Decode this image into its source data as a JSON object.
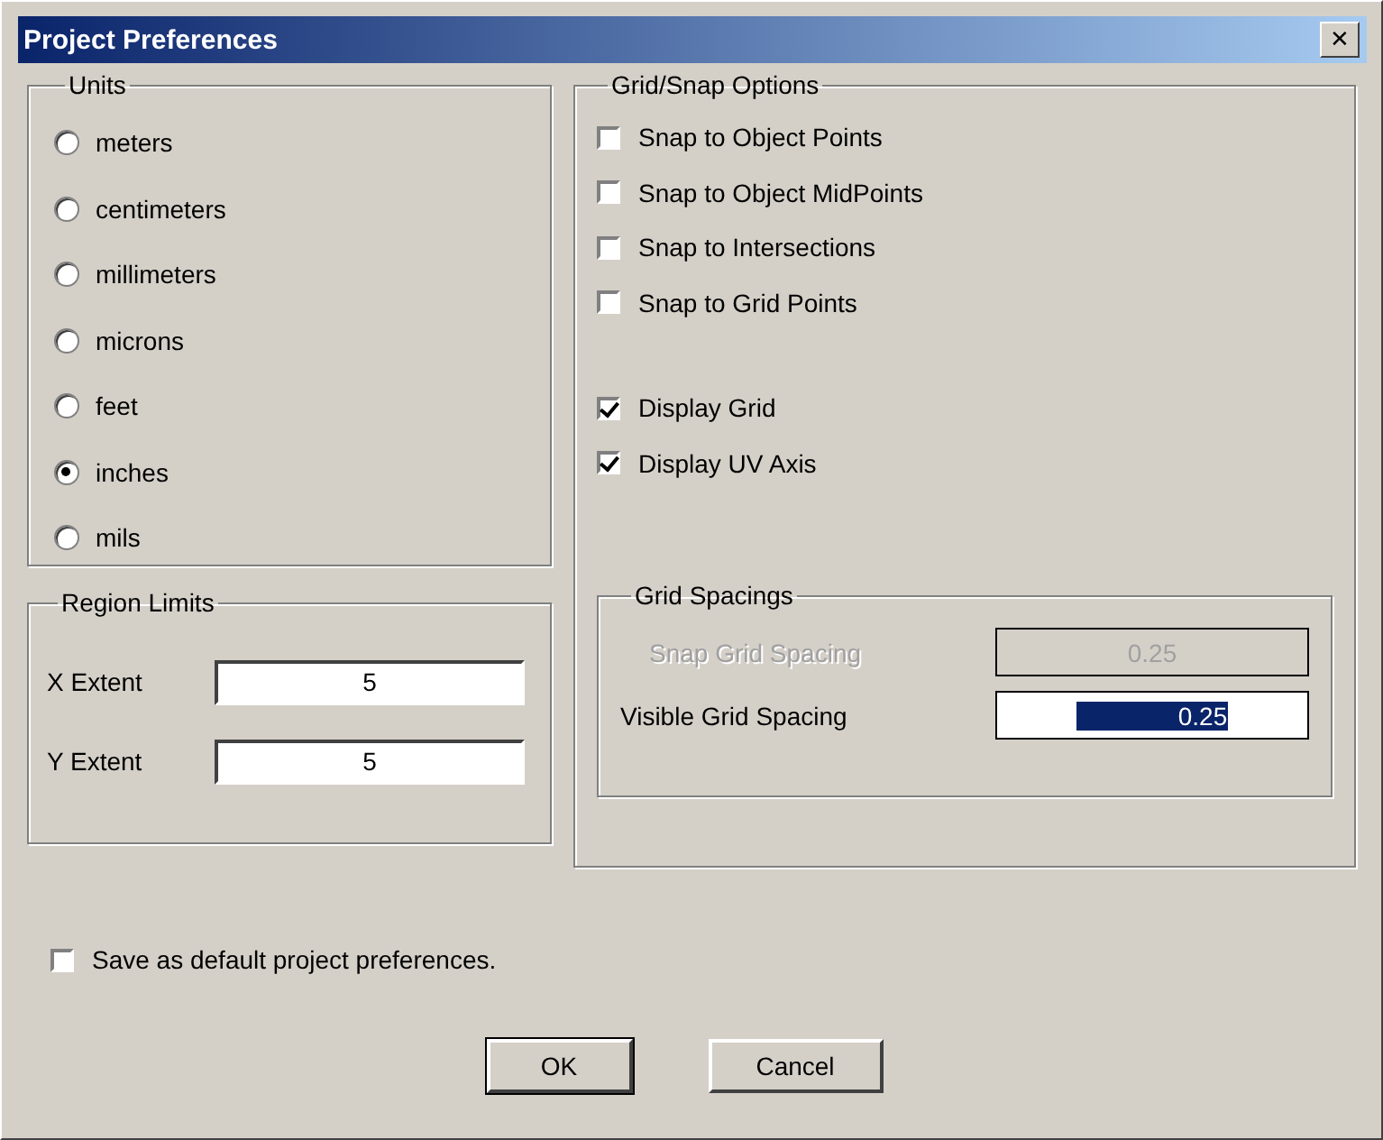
{
  "window": {
    "title": "Project Preferences",
    "close": "✕"
  },
  "units": {
    "title": "Units",
    "options": [
      {
        "label": "meters",
        "selected": false
      },
      {
        "label": "centimeters",
        "selected": false
      },
      {
        "label": "millimeters",
        "selected": false
      },
      {
        "label": "microns",
        "selected": false
      },
      {
        "label": "feet",
        "selected": false
      },
      {
        "label": "inches",
        "selected": true
      },
      {
        "label": "mils",
        "selected": false
      }
    ]
  },
  "region_limits": {
    "title": "Region Limits",
    "fields": [
      {
        "label": "X Extent",
        "value": "5"
      },
      {
        "label": "Y Extent",
        "value": "5"
      }
    ]
  },
  "grid_snap": {
    "title": "Grid/Snap Options",
    "snap_options": [
      {
        "label": "Snap to Object Points",
        "checked": false
      },
      {
        "label": "Snap to Object MidPoints",
        "checked": false
      },
      {
        "label": "Snap to Intersections",
        "checked": false
      },
      {
        "label": "Snap to Grid Points",
        "checked": false
      }
    ],
    "display_options": [
      {
        "label": "Display Grid",
        "checked": true
      },
      {
        "label": "Display UV Axis",
        "checked": true
      }
    ],
    "grid_spacings": {
      "title": "Grid Spacings",
      "fields": [
        {
          "label": "Snap Grid Spacing",
          "value": "0.25",
          "disabled": true,
          "text_selected": false
        },
        {
          "label": "Visible Grid Spacing",
          "value": "0.25",
          "disabled": false,
          "text_selected": true
        }
      ]
    }
  },
  "save_default": {
    "label": "Save as default project preferences.",
    "checked": false
  },
  "buttons": [
    {
      "label": "OK",
      "default": true
    },
    {
      "label": "Cancel",
      "default": false
    }
  ]
}
